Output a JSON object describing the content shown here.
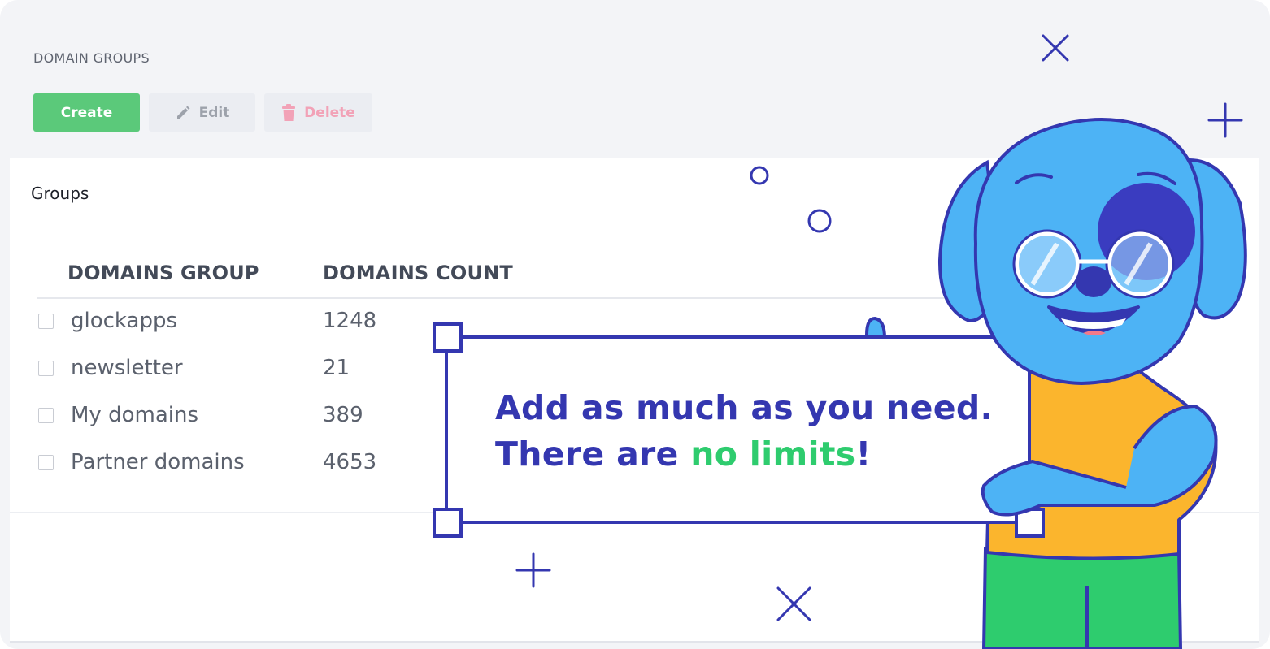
{
  "header": {
    "title": "DOMAIN GROUPS"
  },
  "toolbar": {
    "create_label": "Create",
    "edit_label": "Edit",
    "delete_label": "Delete"
  },
  "panel": {
    "title": "Groups",
    "columns": [
      "DOMAINS GROUP",
      "DOMAINS COUNT"
    ],
    "rows": [
      {
        "name": "glockapps",
        "count": "1248"
      },
      {
        "name": "newsletter",
        "count": "21"
      },
      {
        "name": "My domains",
        "count": "389"
      },
      {
        "name": "Partner domains",
        "count": "4653"
      }
    ]
  },
  "promo": {
    "line1": "Add as much as you need.",
    "line2_prefix": "There are ",
    "line2_highlight": "no limits",
    "line2_suffix": "!"
  },
  "icons": [
    "pencil-icon",
    "trash-icon",
    "close-icon",
    "plus-icon",
    "circle-decoration"
  ],
  "colors": {
    "create_button": "#5bc97a",
    "delete_text": "#f2a2b7",
    "promo_text": "#3437b0",
    "promo_highlight": "#2ecc6e",
    "mascot_blue": "#4db3f5",
    "mascot_outline": "#3437b0",
    "shirt": "#fbb52d",
    "pants": "#2ecc6e"
  }
}
